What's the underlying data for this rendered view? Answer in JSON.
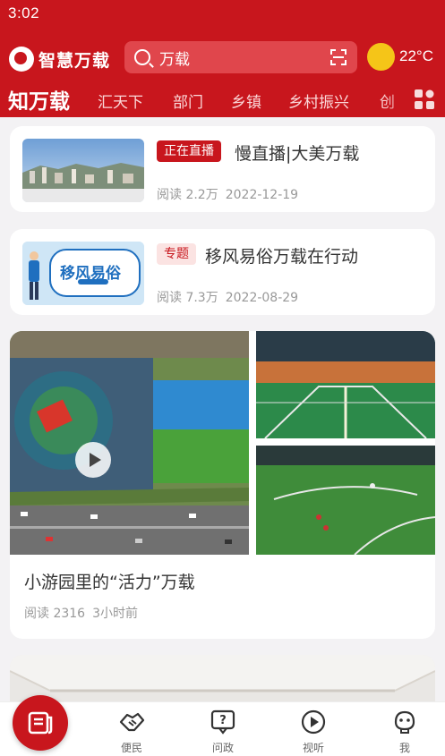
{
  "status_bar": {
    "time": "3:02"
  },
  "header": {
    "app_name": "智慧万载",
    "search_text": "万载",
    "temperature": "22°C",
    "weather_icon": "sun-icon"
  },
  "tabs": [
    "知万载",
    "汇天下",
    "部门",
    "乡镇",
    "乡村振兴",
    "创"
  ],
  "articles": [
    {
      "badge": "正在直播",
      "title": "慢直播|大美万载",
      "reads": "阅读 2.2万",
      "date": "2022-12-19"
    },
    {
      "badge": "专题",
      "title": "移风易俗万载在行动",
      "reads": "阅读 7.3万",
      "date": "2022-08-29",
      "thumb_text": "移风易俗"
    }
  ],
  "feature": {
    "title": "小游园里的“活力”万载",
    "reads": "阅读 2316",
    "time": "3小时前"
  },
  "bottom_nav": [
    {
      "label": "便民",
      "icon": "handshake-icon"
    },
    {
      "label": "问政",
      "icon": "question-bubble-icon"
    },
    {
      "label": "视听",
      "icon": "play-circle-icon"
    },
    {
      "label": "我",
      "icon": "profile-icon"
    }
  ],
  "colors": {
    "brand": "#c8161d",
    "sun": "#f5c518"
  }
}
